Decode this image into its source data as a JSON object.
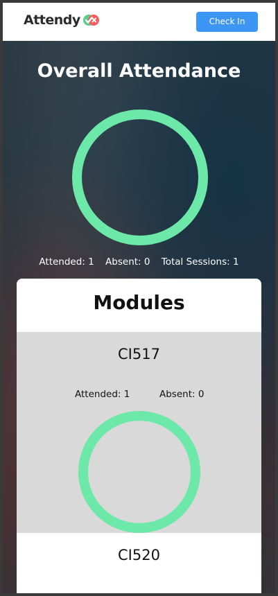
{
  "app": {
    "brand": "Attendy",
    "accent_color": "#3e96f4",
    "ring_color": "#6ce8a8",
    "logo_icon": "check-cross-logo-icon"
  },
  "navbar": {
    "check_in_label": "Check In"
  },
  "overall": {
    "title": "Overall Attendance",
    "attended_label": "Attended: 1",
    "absent_label": "Absent: 0",
    "total_label": "Total Sessions: 1",
    "attendance_fraction": 1.0
  },
  "modules": {
    "title": "Modules",
    "items": [
      {
        "code": "CI517",
        "attended_label": "Attended: 1",
        "absent_label": "Absent: 0",
        "attendance_fraction": 1.0
      },
      {
        "code": "CI520"
      }
    ]
  }
}
